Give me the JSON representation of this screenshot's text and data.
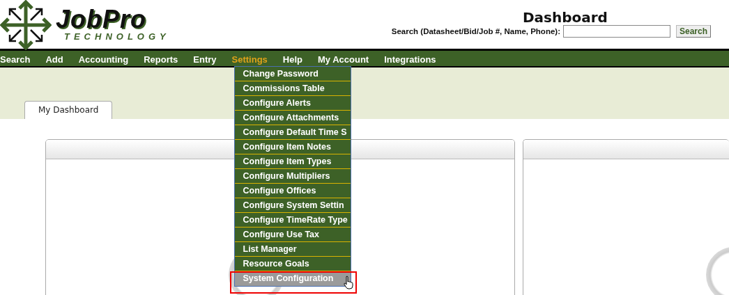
{
  "logo": {
    "name": "JobPro",
    "tagline": "TECHNOLOGY"
  },
  "header": {
    "title": "Dashboard",
    "search_label": "Search (Datasheet/Bid/Job #, Name, Phone):",
    "search_button": "Search"
  },
  "nav": [
    {
      "label": "Search",
      "selected": false
    },
    {
      "label": "Add",
      "selected": false
    },
    {
      "label": "Accounting",
      "selected": false
    },
    {
      "label": "Reports",
      "selected": false
    },
    {
      "label": "Entry",
      "selected": false
    },
    {
      "label": "Settings",
      "selected": true
    },
    {
      "label": "Help",
      "selected": false
    },
    {
      "label": "My Account",
      "selected": false
    },
    {
      "label": "Integrations",
      "selected": false
    }
  ],
  "settings_menu": [
    {
      "label": "Change Password",
      "selected": false
    },
    {
      "label": "Commissions Table",
      "selected": false
    },
    {
      "label": "Configure Alerts",
      "selected": false
    },
    {
      "label": "Configure Attachments",
      "selected": false
    },
    {
      "label": "Configure Default Time S",
      "selected": false
    },
    {
      "label": "Configure Item Notes",
      "selected": false
    },
    {
      "label": "Configure Item Types",
      "selected": false
    },
    {
      "label": "Configure Multipliers",
      "selected": false
    },
    {
      "label": "Configure Offices",
      "selected": false
    },
    {
      "label": "Configure System Settin",
      "selected": false
    },
    {
      "label": "Configure TimeRate Type",
      "selected": false
    },
    {
      "label": "Configure Use Tax",
      "selected": false
    },
    {
      "label": "List Manager",
      "selected": false
    },
    {
      "label": "Resource Goals",
      "selected": false
    },
    {
      "label": "System Configuration",
      "selected": true
    }
  ],
  "tabs": [
    {
      "label": "My Dashboard",
      "selected": true
    }
  ]
}
